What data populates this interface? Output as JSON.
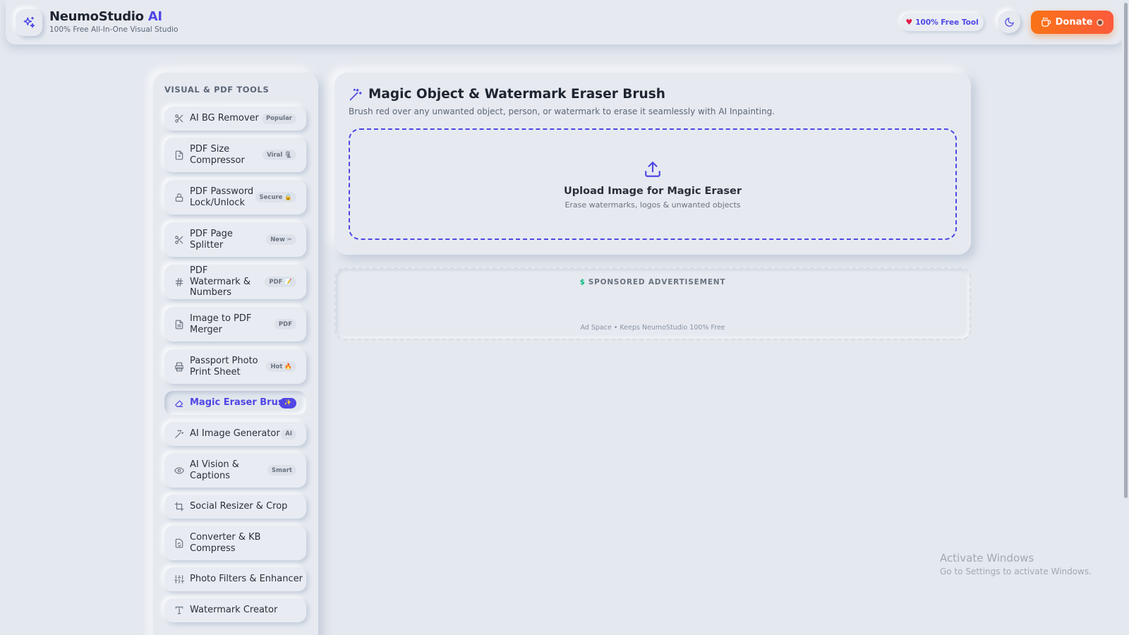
{
  "header": {
    "brand_name": "NeumoStudio",
    "brand_ai": "AI",
    "tagline": "100% Free All-In-One Visual Studio",
    "free_label": "100% Free Tool",
    "donate_label": "Donate"
  },
  "sidebar": {
    "title": "VISUAL & PDF TOOLS",
    "items": [
      {
        "label": "AI BG Remover",
        "badge": "Popular"
      },
      {
        "label": "PDF Size Compressor",
        "badge": "Viral 🗜"
      },
      {
        "label": "PDF Password Lock/Unlock",
        "badge": "Secure 🔒"
      },
      {
        "label": "PDF Page Splitter",
        "badge": "New ✂"
      },
      {
        "label": "PDF Watermark & Numbers",
        "badge": "PDF 📝"
      },
      {
        "label": "Image to PDF Merger",
        "badge": "PDF"
      },
      {
        "label": "Passport Photo Print Sheet",
        "badge": "Hot 🔥"
      },
      {
        "label": "Magic Eraser Brush",
        "badge": "✨"
      },
      {
        "label": "AI Image Generator",
        "badge": "AI"
      },
      {
        "label": "AI Vision & Captions",
        "badge": "Smart"
      },
      {
        "label": "Social Resizer & Crop",
        "badge": ""
      },
      {
        "label": "Converter & KB Compress",
        "badge": ""
      },
      {
        "label": "Photo Filters & Enhancer",
        "badge": ""
      },
      {
        "label": "Watermark Creator",
        "badge": ""
      }
    ]
  },
  "main": {
    "title": "Magic Object & Watermark Eraser Brush",
    "description": "Brush red over any unwanted object, person, or watermark to erase it seamlessly with AI Inpainting.",
    "upload_title": "Upload Image for Magic Eraser",
    "upload_sub": "Erase watermarks, logos & unwanted objects"
  },
  "ad": {
    "label": "SPONSORED ADVERTISEMENT",
    "footer": "Ad Space • Keeps NeumoStudio 100% Free"
  },
  "os_watermark": {
    "line1": "Activate Windows",
    "line2": "Go to Settings to activate Windows."
  },
  "colors": {
    "accent": "#4f46e5",
    "donate": "#f97316",
    "background": "#e4e8ef"
  },
  "icons": {
    "logo": "sparkles-icon",
    "theme": "moon-icon",
    "donate": "coffee-icon",
    "tool_title": "magic-wand-icon",
    "upload": "upload-icon"
  }
}
